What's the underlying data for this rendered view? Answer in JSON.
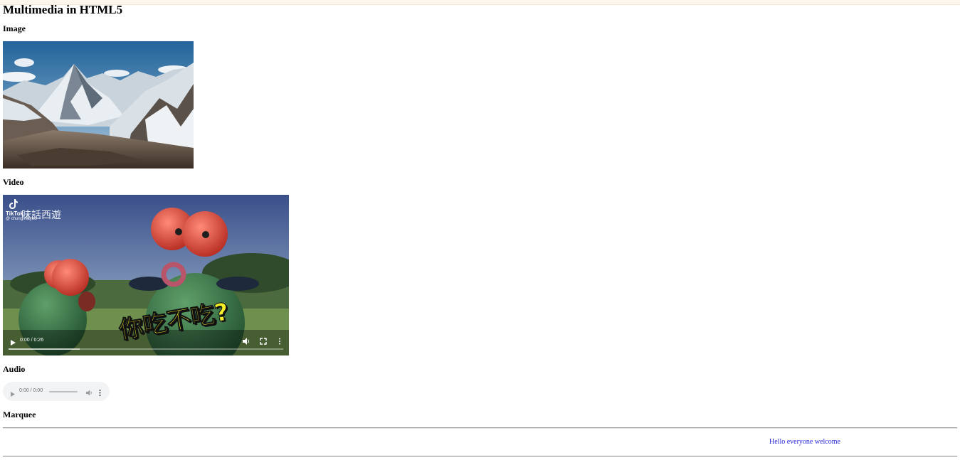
{
  "page": {
    "title": "Multimedia in HTML5"
  },
  "sections": {
    "image": {
      "heading": "Image",
      "icon": "mountain-landscape-photo"
    },
    "video": {
      "heading": "Video",
      "overlay_brand": "TikTok",
      "overlay_handle": "@ chungmiayoo",
      "overlay_title_cn": "味話西遊",
      "caption_cn": "你吃不吃?",
      "time_display": "0:00 / 0:26",
      "progress": 0.0
    },
    "audio": {
      "heading": "Audio",
      "time_display": "0:00 / 0:00",
      "progress": 0.0
    },
    "marquee": {
      "heading": "Marquee",
      "text": "Hello everyone welcome",
      "color": "#1f1fd8"
    }
  },
  "colors": {
    "top_band": "#fdf6ec",
    "audio_bg": "#f1f3f4",
    "marquee_text": "#1f1fd8"
  }
}
